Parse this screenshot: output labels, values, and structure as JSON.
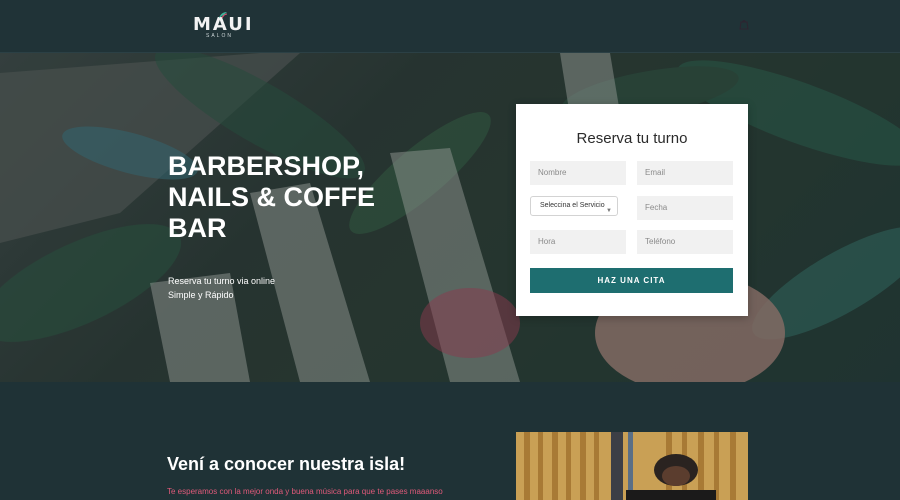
{
  "header": {
    "logo_word": "MAUI",
    "logo_sub": "SALON",
    "menu_icon": "bag-icon"
  },
  "hero": {
    "title_lines": [
      "BARBERSHOP,",
      "NAILS & COFFE",
      "BAR"
    ],
    "sub_lines": [
      "Reserva tu turno via online",
      "Simple y Rápido"
    ]
  },
  "booking": {
    "title": "Reserva tu turno",
    "name_placeholder": "Nombre",
    "email_placeholder": "Email",
    "service_selected": "Seleccina el Servicio",
    "date_placeholder": "Fecha",
    "time_placeholder": "Hora",
    "phone_placeholder": "Teléfono",
    "submit_label": "HAZ UNA CITA"
  },
  "section": {
    "title": "Vení a conocer nuestra isla!",
    "text": "Te esperamos con la mejor onda y buena música para que te pases maaanso"
  },
  "colors": {
    "header_bg": "#203337",
    "accent": "#1e6e70",
    "pink_text": "#e05a7a"
  }
}
